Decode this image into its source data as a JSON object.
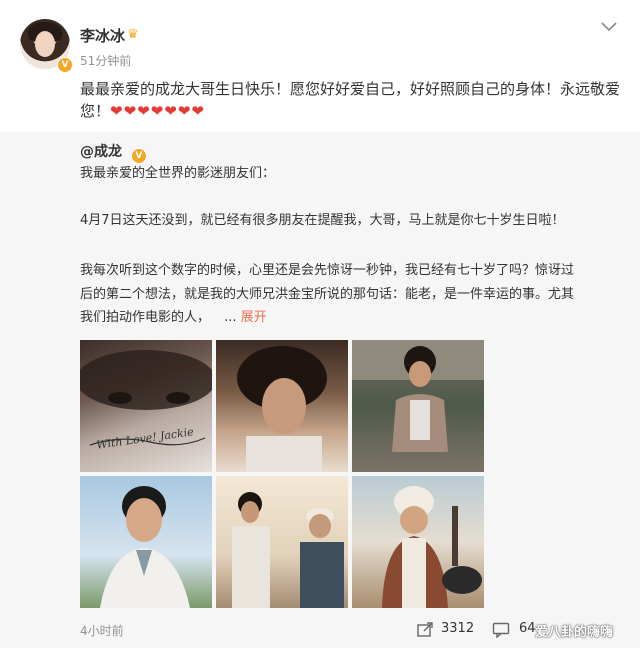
{
  "post": {
    "author": "李冰冰",
    "time": "51分钟前",
    "text": "最最亲爱的成龙大哥生日快乐！愿您好好爱自己，好好照顾自己的身体！永远敬爱您！",
    "hearts": "❤❤❤❤❤❤❤",
    "verified_badge": "V",
    "author_badge_icon": "crown-icon"
  },
  "repost": {
    "author": "@成龙",
    "verified_badge": "V",
    "lines": [
      "我最亲爱的全世界的影迷朋友们：",
      "4月7日这天还没到，就已经有很多朋友在提醒我，大哥，马上就是你七十岁生日啦！",
      "我每次听到这个数字的时候，心里还是会先惊讶一秒钟，我已经有七十岁了吗？惊讶过",
      "后的第二个想法，就是我的大师兄洪金宝所说的那句话：能老，是一件幸运的事。尤其",
      "我们拍动作电影的人，"
    ],
    "ellipsis": "...",
    "expand_label": "展开",
    "photo_signature": "With Love! Jackie"
  },
  "footer": {
    "time": "4小时前",
    "repost_count": "3312",
    "comment_count": "64",
    "watermark": "爱八卦的嗨嗨"
  },
  "colors": {
    "accent": "#eb7350",
    "heart": "#e53935",
    "badge": "#f5a623",
    "meta_text": "#939393",
    "repost_bg": "#f6f6f6"
  }
}
